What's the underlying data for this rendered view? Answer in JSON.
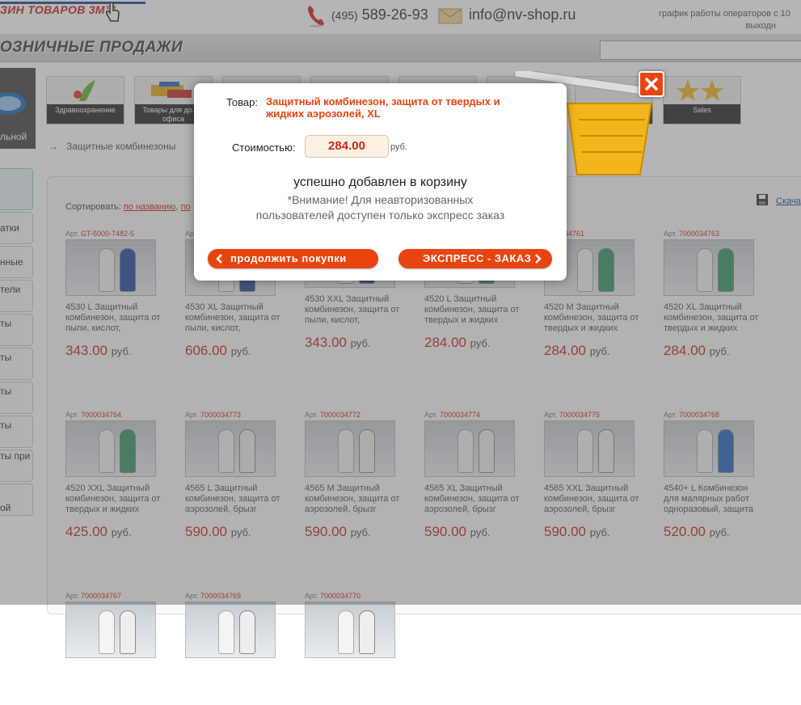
{
  "header": {
    "logo_text": "ЗИН ТОВАРОВ 3М™",
    "phone_code": "(495)",
    "phone_number": "589-26-93",
    "email": "info@nv-shop.ru",
    "schedule_line1": "график работы операторов с 10",
    "schedule_line2": "выходн"
  },
  "subbar": {
    "title": "ОЗНИЧНЫЕ ПРОДАЖИ",
    "search_placeholder": ""
  },
  "sidebar": {
    "top_label": "льной",
    "items": [
      "",
      "атки",
      "нные",
      "тели",
      "ты",
      "ты",
      "ты",
      "ты",
      "ты при",
      "ой"
    ]
  },
  "categories": [
    {
      "label": "Здравоохранение"
    },
    {
      "label": "Товары для до... и офиса"
    },
    {
      "label": ""
    },
    {
      "label": ""
    },
    {
      "label": ""
    },
    {
      "label": ""
    },
    {
      "label": ""
    },
    {
      "label": "Sales"
    }
  ],
  "breadcrumb": {
    "arrow": "→",
    "text": "Защитные комбинезоны"
  },
  "sort": {
    "label": "Сортировать:",
    "by_name": "по названию",
    "by_price": "по"
  },
  "download": {
    "label": "Скача"
  },
  "products": [
    {
      "art_label": "Арт.",
      "art": "GT-5000-7482-5",
      "name": "4530 L Защитный комбинезон, защита от пыли, кислот,",
      "price": "343.00",
      "currency": "руб."
    },
    {
      "art_label": "Арт.",
      "art": "",
      "name": "4530 XL Защитный комбинезон, защита от пыли, кислот,",
      "price": "606.00",
      "currency": "руб."
    },
    {
      "art_label": "",
      "art": "",
      "name": "4530 XXL Защитный комбинезон, защита от пыли, кислот,",
      "price": "343.00",
      "currency": "руб."
    },
    {
      "art_label": "",
      "art": "",
      "name": "4520 L Защитный комбинезон, защита от твердых и жидких",
      "price": "284.00",
      "currency": "руб."
    },
    {
      "art_label": "",
      "art": "7000034761",
      "name": "4520 M Защитный комбинезон, защита от твердых и жидких",
      "price": "284.00",
      "currency": "руб."
    },
    {
      "art_label": "Арт.",
      "art": "7000034763",
      "name": "4520 XL Защитный комбинезон, защита от твердых и жидких",
      "price": "284.00",
      "currency": "руб."
    },
    {
      "art_label": "Арт.",
      "art": "7000034764",
      "name": "4520 XXL Защитный комбинезон, защита от твердых и жидких",
      "price": "425.00",
      "currency": "руб."
    },
    {
      "art_label": "Арт.",
      "art": "7000034773",
      "name": "4565 L Защитный комбинезон, защита от аэрозолей, брызг",
      "price": "590.00",
      "currency": "руб."
    },
    {
      "art_label": "Арт.",
      "art": "7000034772",
      "name": "4565 M Защитный комбинезон, защита от аэрозолей, брызг",
      "price": "590.00",
      "currency": "руб."
    },
    {
      "art_label": "Арт.",
      "art": "7000034774",
      "name": "4565 XL Защитный комбинезон, защита от аэрозолей, брызг",
      "price": "590.00",
      "currency": "руб."
    },
    {
      "art_label": "Арт.",
      "art": "7000034775",
      "name": "4565 XXL Защитный комбинезон, защита от аэрозолей, брызг",
      "price": "590.00",
      "currency": "руб."
    },
    {
      "art_label": "Арт.",
      "art": "7000034768",
      "name": "4540+ L Комбинезон для малярных работ одноразовый, защита",
      "price": "520.00",
      "currency": "руб."
    },
    {
      "art_label": "Арт.",
      "art": "7000034767",
      "name": "",
      "price": "",
      "currency": ""
    },
    {
      "art_label": "Арт.",
      "art": "7000034769",
      "name": "",
      "price": "",
      "currency": ""
    },
    {
      "art_label": "Арт.",
      "art": "7000034770",
      "name": "",
      "price": "",
      "currency": ""
    }
  ],
  "modal": {
    "goods_label": "Товар:",
    "goods_name": "Защитный комбинезон, защита от твердых и жидких аэрозолей, XL",
    "cost_label": "Стоимостью:",
    "cost_value": "284.00",
    "cost_currency": "руб.",
    "success_text": "успешно добавлен в корзину",
    "warning_text": "*Внимание! Для неавторизованных пользователей доступен только экспресс заказ",
    "continue_label": "продолжить покупки",
    "express_label": "ЭКСПРЕСС - ЗАКАЗ"
  },
  "colors": {
    "accent": "#e8440f",
    "price": "#c8281e",
    "brand_blue": "#1a4f9c"
  },
  "icons": [
    "hand-cursor-icon",
    "phone-icon",
    "mail-icon",
    "save-icon",
    "chevron-left-icon",
    "chevron-right-icon",
    "close-icon",
    "basket-icon"
  ]
}
